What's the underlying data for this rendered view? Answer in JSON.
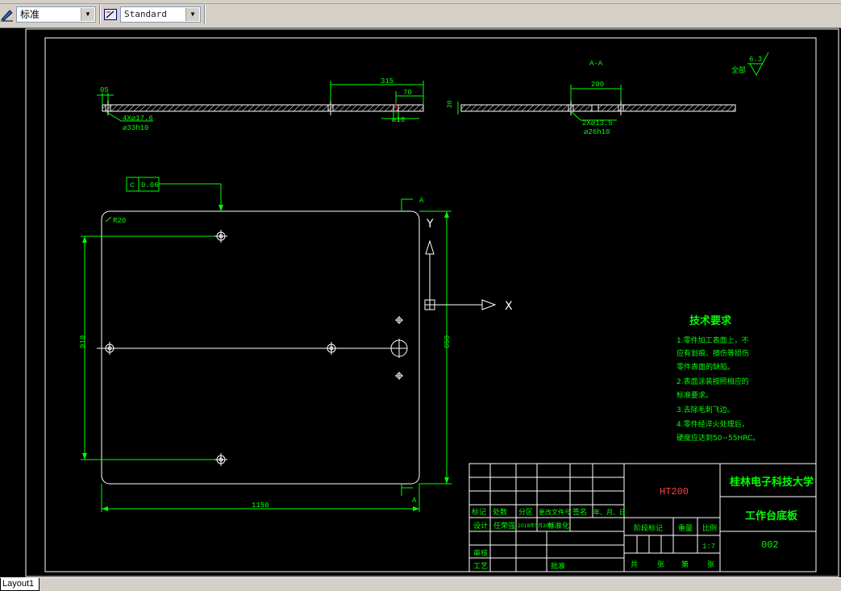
{
  "toolbar": {
    "text_style_value": "标准",
    "dim_style_value": "Standard"
  },
  "drawing": {
    "section_label": "A-A",
    "surface_finish_label": "全部",
    "surface_finish_value": "6.3",
    "dims": {
      "d05": "05",
      "d315": "315",
      "d70": "70",
      "d10": "⌀10",
      "d20": "20",
      "d200": "200",
      "hole_a": "4X⌀17.6",
      "hole_a_sub": "⌀33h10",
      "hole_b": "2X⌀13.5",
      "hole_b_sub": "⌀26h10",
      "radius": "R20",
      "w1150": "1150",
      "h910": "910",
      "h850": "850"
    },
    "tolerance_symbol": "c",
    "tolerance_value": "0.06",
    "view_a_top": "A",
    "view_a_bottom": "A",
    "ucs_y": "Y",
    "ucs_x": "X"
  },
  "tech": {
    "title": "技术要求",
    "lines": [
      "1.零件加工表面上，不",
      "应有划痕、擦伤等损伤",
      "零件表面的缺陷。",
      "2.表面涂装按照相应的",
      "标准要求。",
      "3.去除毛刺飞边。",
      "4.零件经淬火处理后，",
      "硬度应达到50~55HRC。"
    ]
  },
  "title_block": {
    "model": "HT200",
    "school": "桂林电子科技大学",
    "part_name": "工作台底板",
    "drawing_no": "002",
    "h_mark": "标记",
    "h_count": "处数",
    "h_zone": "分区",
    "h_doc": "更改文件号",
    "h_sign": "签名",
    "h_date": "年、月、日",
    "design_label": "设计",
    "designer": "任荣强",
    "design_date": "2018年5月20日",
    "standard_label": "标准化",
    "stage_label": "阶段标记",
    "weight_label": "重量",
    "scale_label": "比例",
    "scale_value": "1:7",
    "check_label": "审核",
    "process_label": "工艺",
    "approve_label": "批准",
    "sheet_total": "共",
    "sheet_unit1": "张",
    "sheet_no": "第",
    "sheet_unit2": "张"
  },
  "status": {
    "layout_tab": "Layout1"
  }
}
